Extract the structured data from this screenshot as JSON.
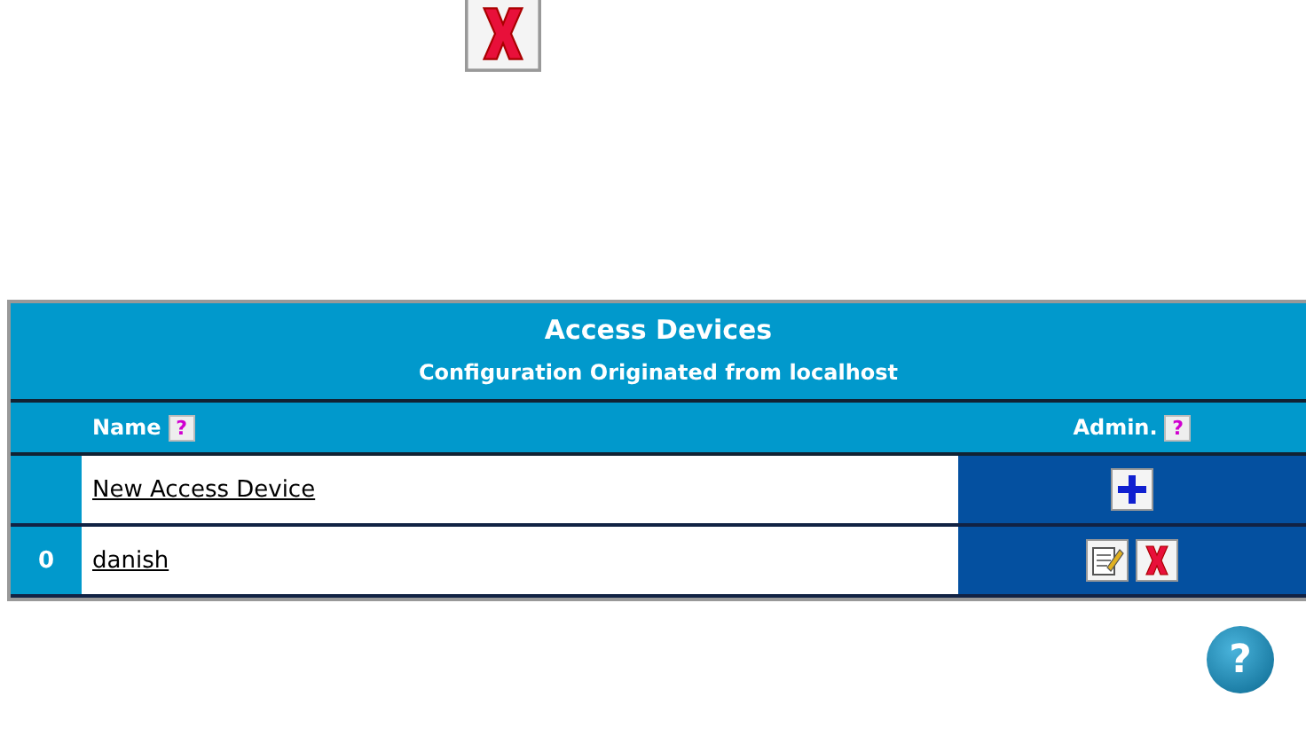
{
  "top_actions": [
    {
      "kind": "delete"
    }
  ],
  "table": {
    "title": "Access Devices",
    "subtitle": "Configuration Originated from localhost",
    "columns": [
      {
        "label": "Name",
        "help": "?"
      },
      {
        "label": "Admin.",
        "help": "?"
      }
    ],
    "rows": [
      {
        "index": "",
        "name": "New Access Device",
        "actions": [
          {
            "kind": "add"
          }
        ]
      },
      {
        "index": "0",
        "name": "danish",
        "actions": [
          {
            "kind": "edit"
          },
          {
            "kind": "delete"
          }
        ]
      }
    ]
  },
  "help_button": "?"
}
